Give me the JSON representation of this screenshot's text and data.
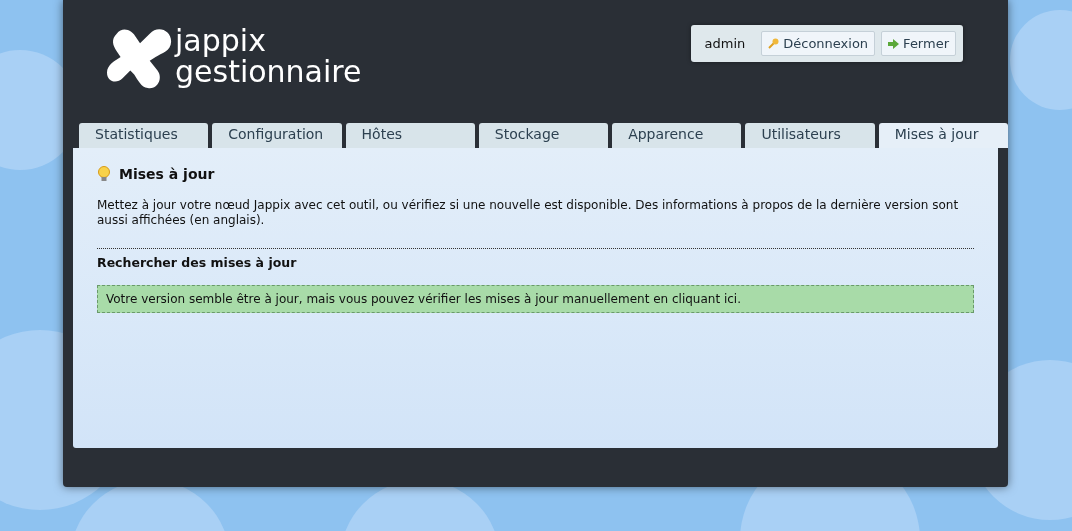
{
  "logo": {
    "line1": "jappix",
    "line2": "gestionnaire"
  },
  "user_box": {
    "username": "admin",
    "buttons": [
      {
        "label": "Déconnexion",
        "kind": "key"
      },
      {
        "label": "Fermer",
        "kind": "arrow"
      }
    ]
  },
  "tabs": [
    {
      "label": "Statistiques",
      "selected": false
    },
    {
      "label": "Configuration",
      "selected": false
    },
    {
      "label": "Hôtes",
      "selected": false
    },
    {
      "label": "Stockage",
      "selected": false
    },
    {
      "label": "Apparence",
      "selected": false
    },
    {
      "label": "Utilisateurs",
      "selected": false
    },
    {
      "label": "Mises à jour",
      "selected": true
    }
  ],
  "panel": {
    "title": "Mises à jour",
    "description": "Mettez à jour votre nœud Jappix avec cet outil, ou vérifiez si une nouvelle est disponible. Des informations à propos de la dernière version sont aussi affichées (en anglais).",
    "section_title": "Rechercher des mises à jour",
    "notice": "Votre version semble être à jour, mais vous pouvez vérifier les mises à jour manuellement en cliquant ici."
  }
}
